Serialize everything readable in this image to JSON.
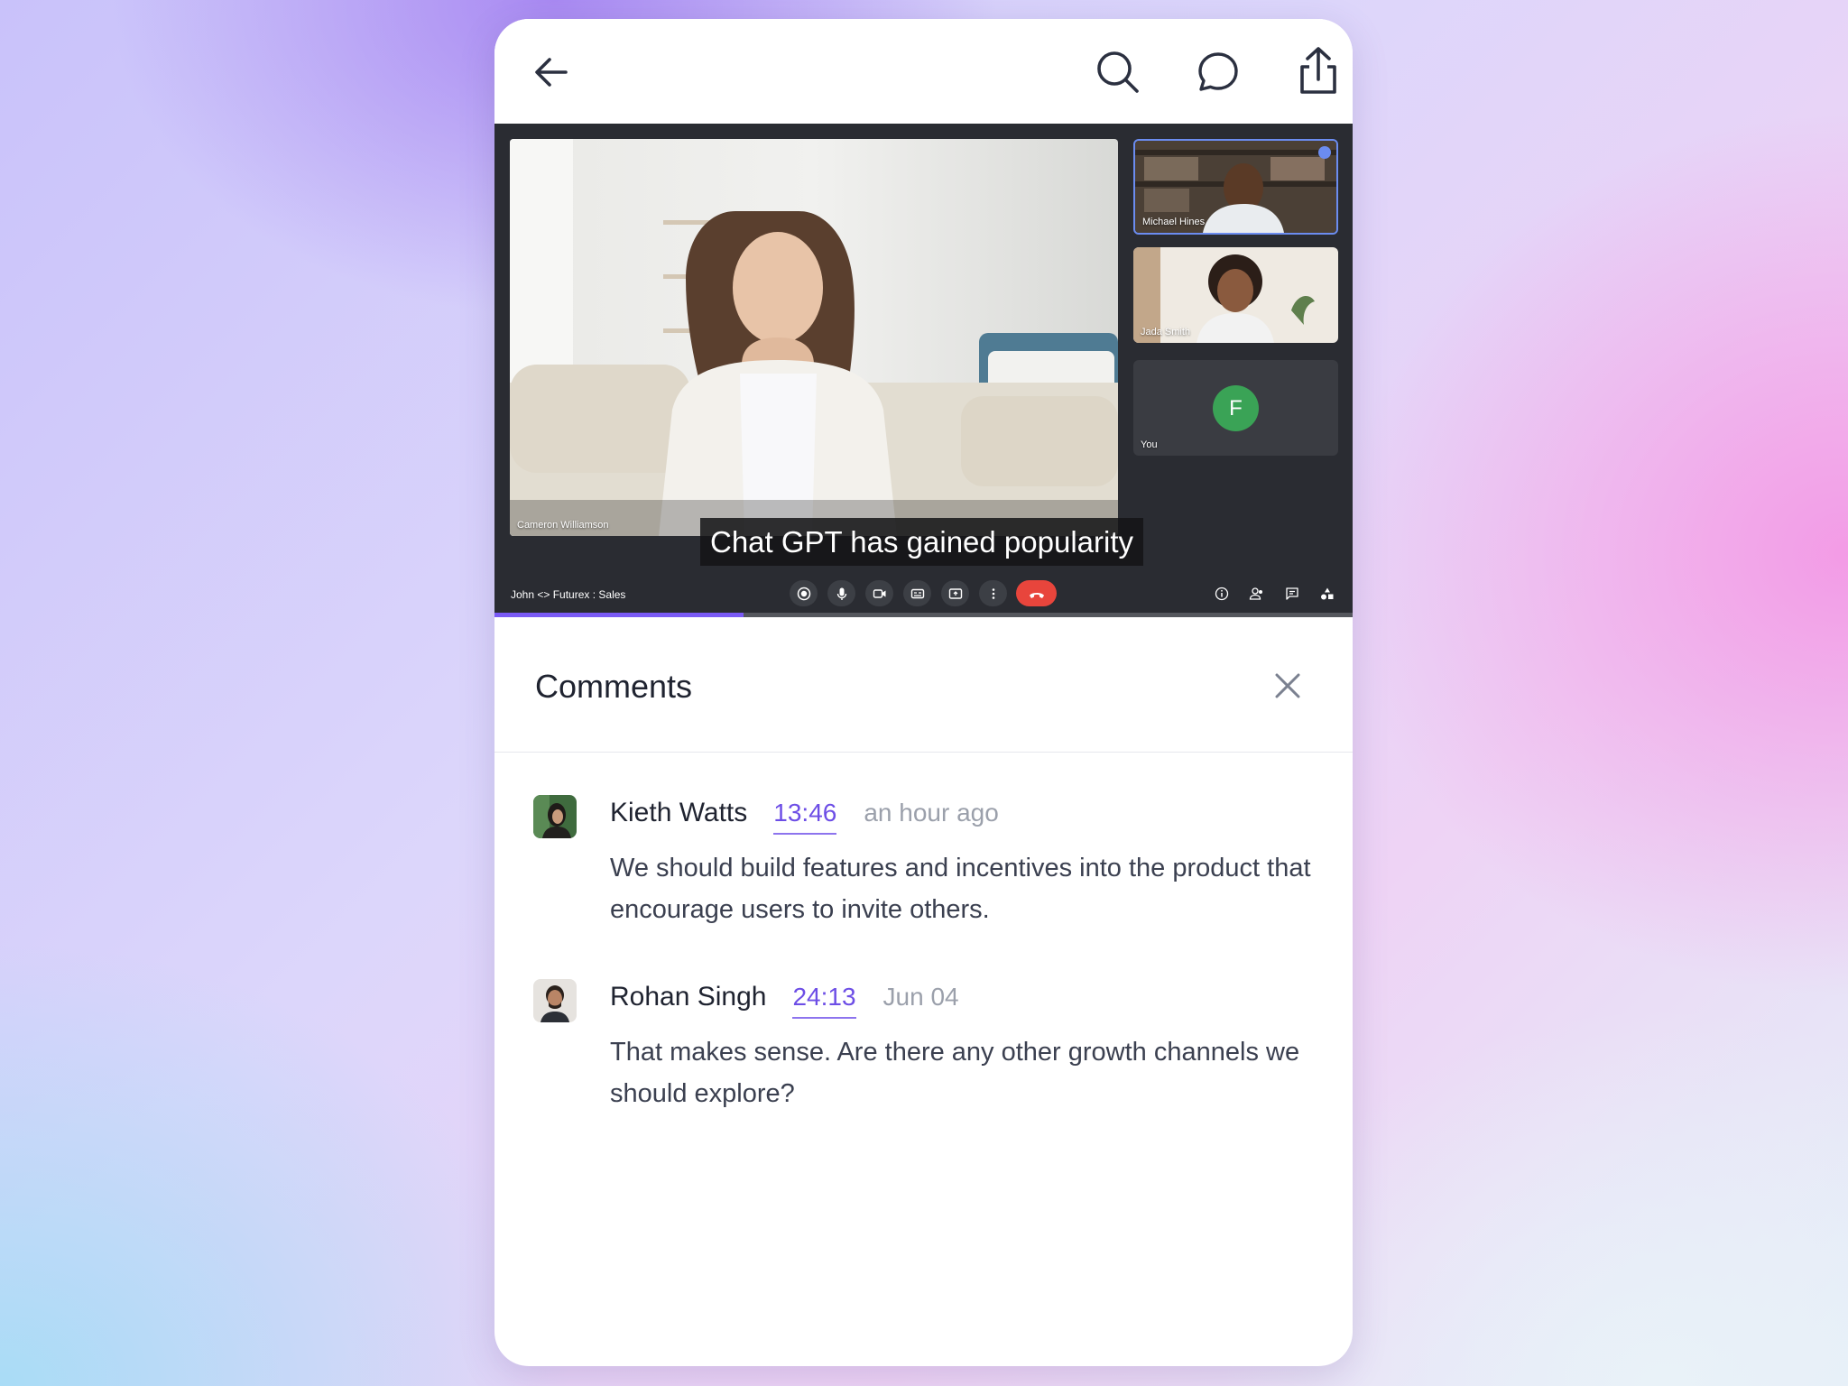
{
  "video": {
    "main_participant": "Cameron Williamson",
    "meeting_title": "John <> Futurex : Sales",
    "caption": "Chat GPT has gained popularity",
    "progress": 0.29,
    "participants": [
      {
        "name": "Michael Hines",
        "active_speaker": true
      },
      {
        "name": "Jada Smith",
        "active_speaker": false
      },
      {
        "name": "You",
        "initial": "F",
        "avatar_color": "#3aa356"
      }
    ],
    "controls": [
      "record-icon",
      "mic-icon",
      "camera-icon",
      "captions-icon",
      "present-icon",
      "more-icon",
      "end-call-icon"
    ],
    "utilities": [
      "info-icon",
      "people-icon",
      "chat-icon",
      "activities-icon"
    ]
  },
  "comments": {
    "title": "Comments",
    "items": [
      {
        "author": "Kieth Watts",
        "timestamp": "13:46",
        "date": "an hour ago",
        "text": "We should build features and incentives into the product that encourage users to invite others."
      },
      {
        "author": "Rohan Singh",
        "timestamp": "24:13",
        "date": "Jun 04",
        "text": "That makes sense. Are there any other growth channels we should explore?"
      }
    ]
  },
  "colors": {
    "accent": "#6d4ee6",
    "end_call": "#e8453c",
    "video_bg": "#2a2c32"
  }
}
